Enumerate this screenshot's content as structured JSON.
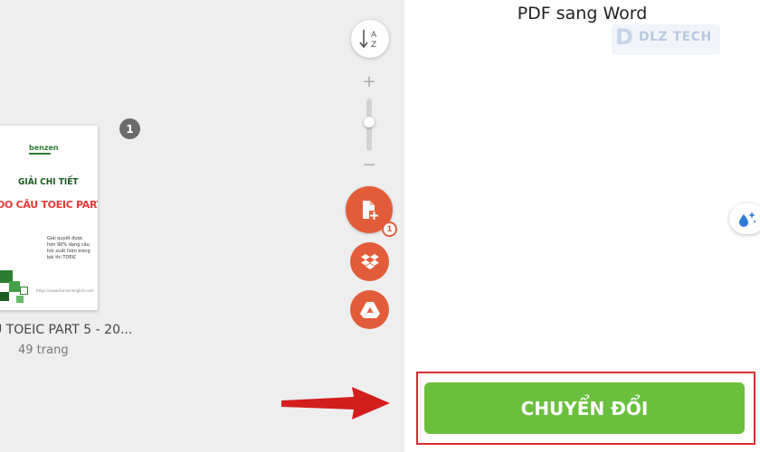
{
  "files": {
    "page_badge": "1",
    "file_name": "U TOEIC PART 5 - 20...",
    "page_count": "49 trang",
    "thumbnail": {
      "brand": "benzen",
      "title_line1": "GIẢI CHI TIẾT",
      "title_line2": "OO CÂU TOEIC PART 5",
      "description": "Giải quyết được hơn 90% dạng câu hỏi xuất hiện trong bài thi TOEIC",
      "url": "https://www.benzenenglish.com"
    }
  },
  "toolbar": {
    "sort_icon_letters": [
      "A",
      "Z"
    ],
    "zoom_plus": "+",
    "zoom_minus": "−",
    "zoom_level": 0.4,
    "add_file_count": "1",
    "accent_color": "#e35c3a"
  },
  "panel": {
    "title": "PDF sang Word",
    "watermark": {
      "text": "DLZ TECH"
    },
    "convert_label": "CHUYỂN ĐỔI",
    "convert_color": "#6abf3d"
  },
  "annotation": {
    "highlight_color": "#d32f2f"
  }
}
